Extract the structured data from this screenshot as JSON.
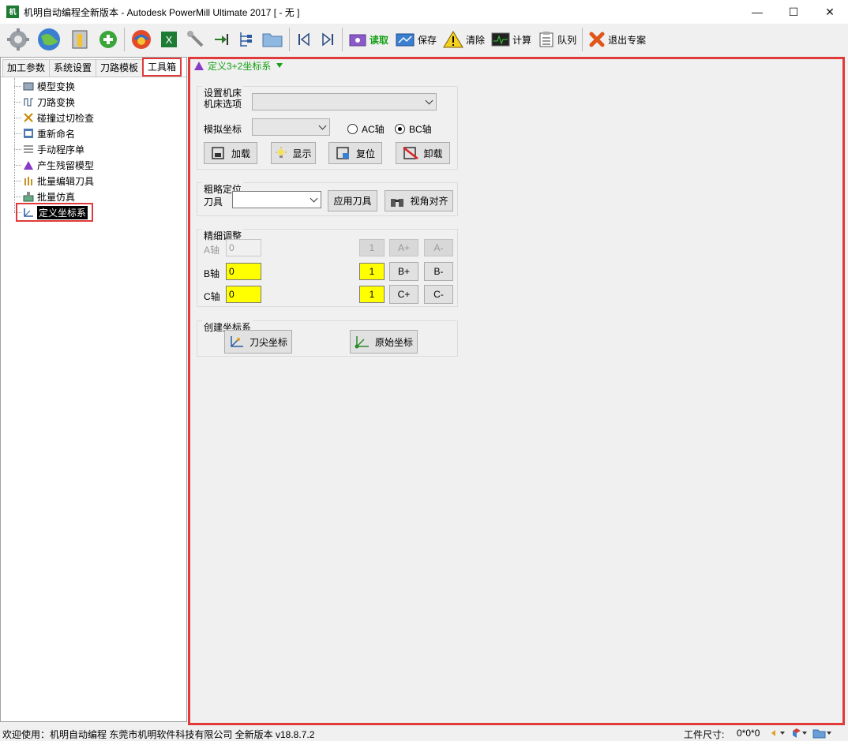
{
  "window": {
    "title": "机明自动编程全新版本 - Autodesk PowerMill Ultimate 2017    [ - 无 ]",
    "icon_text": "机明",
    "minimize": "—",
    "maximize": "☐",
    "close": "✕"
  },
  "toolbar": {
    "read_label": "读取",
    "save_label": "保存",
    "clear_label": "清除",
    "calc_label": "计算",
    "queue_label": "队列",
    "exit_label": "退出专案"
  },
  "left_tabs": [
    "加工参数",
    "系统设置",
    "刀路模板",
    "工具箱"
  ],
  "tree": [
    "模型变换",
    "刀路变换",
    "碰撞过切检查",
    "重新命名",
    "手动程序单",
    "产生残留模型",
    "批量编辑刀具",
    "批量仿真",
    "定义坐标系"
  ],
  "panel": {
    "title": "定义3+2坐标系",
    "machine_group": {
      "title": "设置机床",
      "machine_option_label": "机床选项",
      "machine_option_value": "",
      "sim_coord_label": "模拟坐标",
      "sim_coord_value": "",
      "radio_ac": "AC轴",
      "radio_bc": "BC轴",
      "selected_axis": "BC轴",
      "load": "加载",
      "show": "显示",
      "reset": "复位",
      "unload": "卸载"
    },
    "rough_group": {
      "title": "粗略定位",
      "tool_label": "刀具",
      "tool_value": "",
      "apply_tool": "应用刀具",
      "view_align": "视角对齐"
    },
    "fine_group": {
      "title": "精细调整",
      "a_label": "A轴",
      "a_value": "0",
      "a_step": "1",
      "a_plus": "A+",
      "a_minus": "A-",
      "b_label": "B轴",
      "b_value": "0",
      "b_step": "1",
      "b_plus": "B+",
      "b_minus": "B-",
      "c_label": "C轴",
      "c_value": "0",
      "c_step": "1",
      "c_plus": "C+",
      "c_minus": "C-"
    },
    "create_group": {
      "title": "创建坐标系",
      "tool_tip": "刀尖坐标",
      "origin": "原始坐标"
    }
  },
  "status": {
    "welcome": "欢迎使用：机明自动编程 东莞市机明软件科技有限公司 全新版本 v18.8.7.2",
    "size_label": "工件尺寸:",
    "size_value": "0*0*0"
  },
  "colors": {
    "highlight_red": "#e03a3a",
    "field_yellow": "#ffff00",
    "title_green": "#14a014"
  }
}
